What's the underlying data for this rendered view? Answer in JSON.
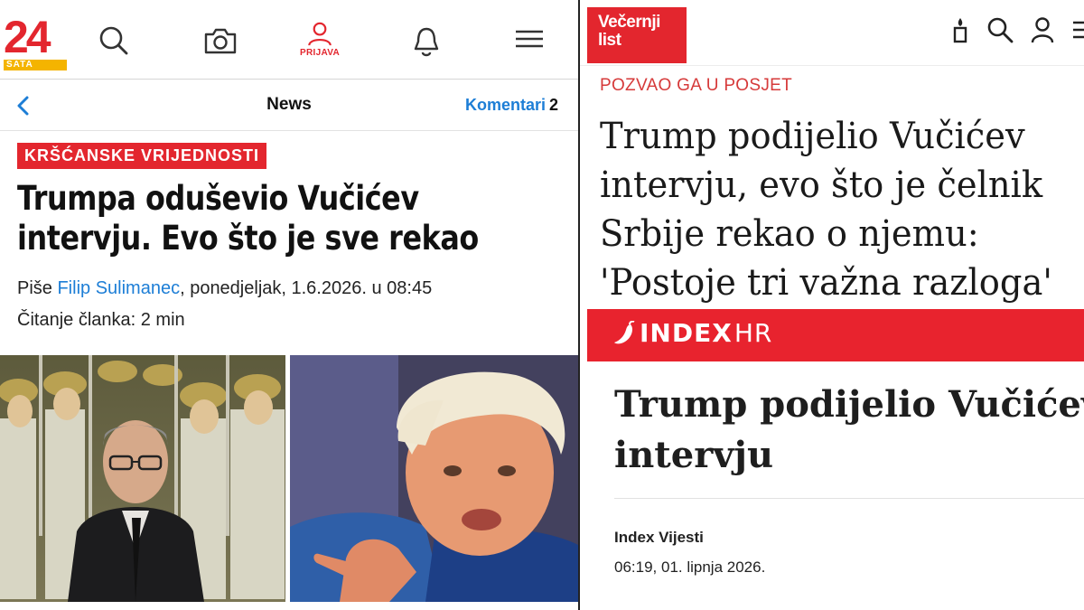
{
  "left": {
    "brand": {
      "logo_number": "24",
      "logo_sub": "SATA"
    },
    "topnav": [
      {
        "icon": "search-icon"
      },
      {
        "icon": "camera-icon"
      },
      {
        "icon": "user-icon",
        "label": "PRIJAVA"
      },
      {
        "icon": "bell-icon"
      },
      {
        "icon": "menu-icon"
      }
    ],
    "subheader": {
      "title": "News",
      "comments_label": "Komentari",
      "comments_count": "2"
    },
    "article": {
      "kicker": "KRŠĆANSKE VRIJEDNOSTI",
      "headline": "Trumpa oduševio Vučićev intervju. Evo što je sve rekao",
      "byline_prefix": "Piše",
      "author": "Filip Sulimanec",
      "date": ", ponedjeljak, 1.6.2026. u 08:45",
      "reading_time": "Čitanje članka: 2 min"
    }
  },
  "right": {
    "vecernji": {
      "logo_line1": "Večernji",
      "logo_line2": "list",
      "kicker": "POZVAO GA U POSJET",
      "headline_lines": [
        "Trump podijelio Vučićev",
        "intervju, evo što je čelnik",
        "Srbije rekao o njemu:",
        "'Postoje tri važna razloga'"
      ]
    },
    "index": {
      "logo": "INDEX",
      "logo_suffix": "HR",
      "headline_lines": [
        "Trump podijelio Vučićev",
        "intervju"
      ],
      "author": "Index Vijesti",
      "date": "06:19, 01. lipnja 2026."
    }
  },
  "colors": {
    "brand_red": "#e3262e",
    "link_blue": "#1d7ed6",
    "accent_yellow": "#f4b400"
  }
}
